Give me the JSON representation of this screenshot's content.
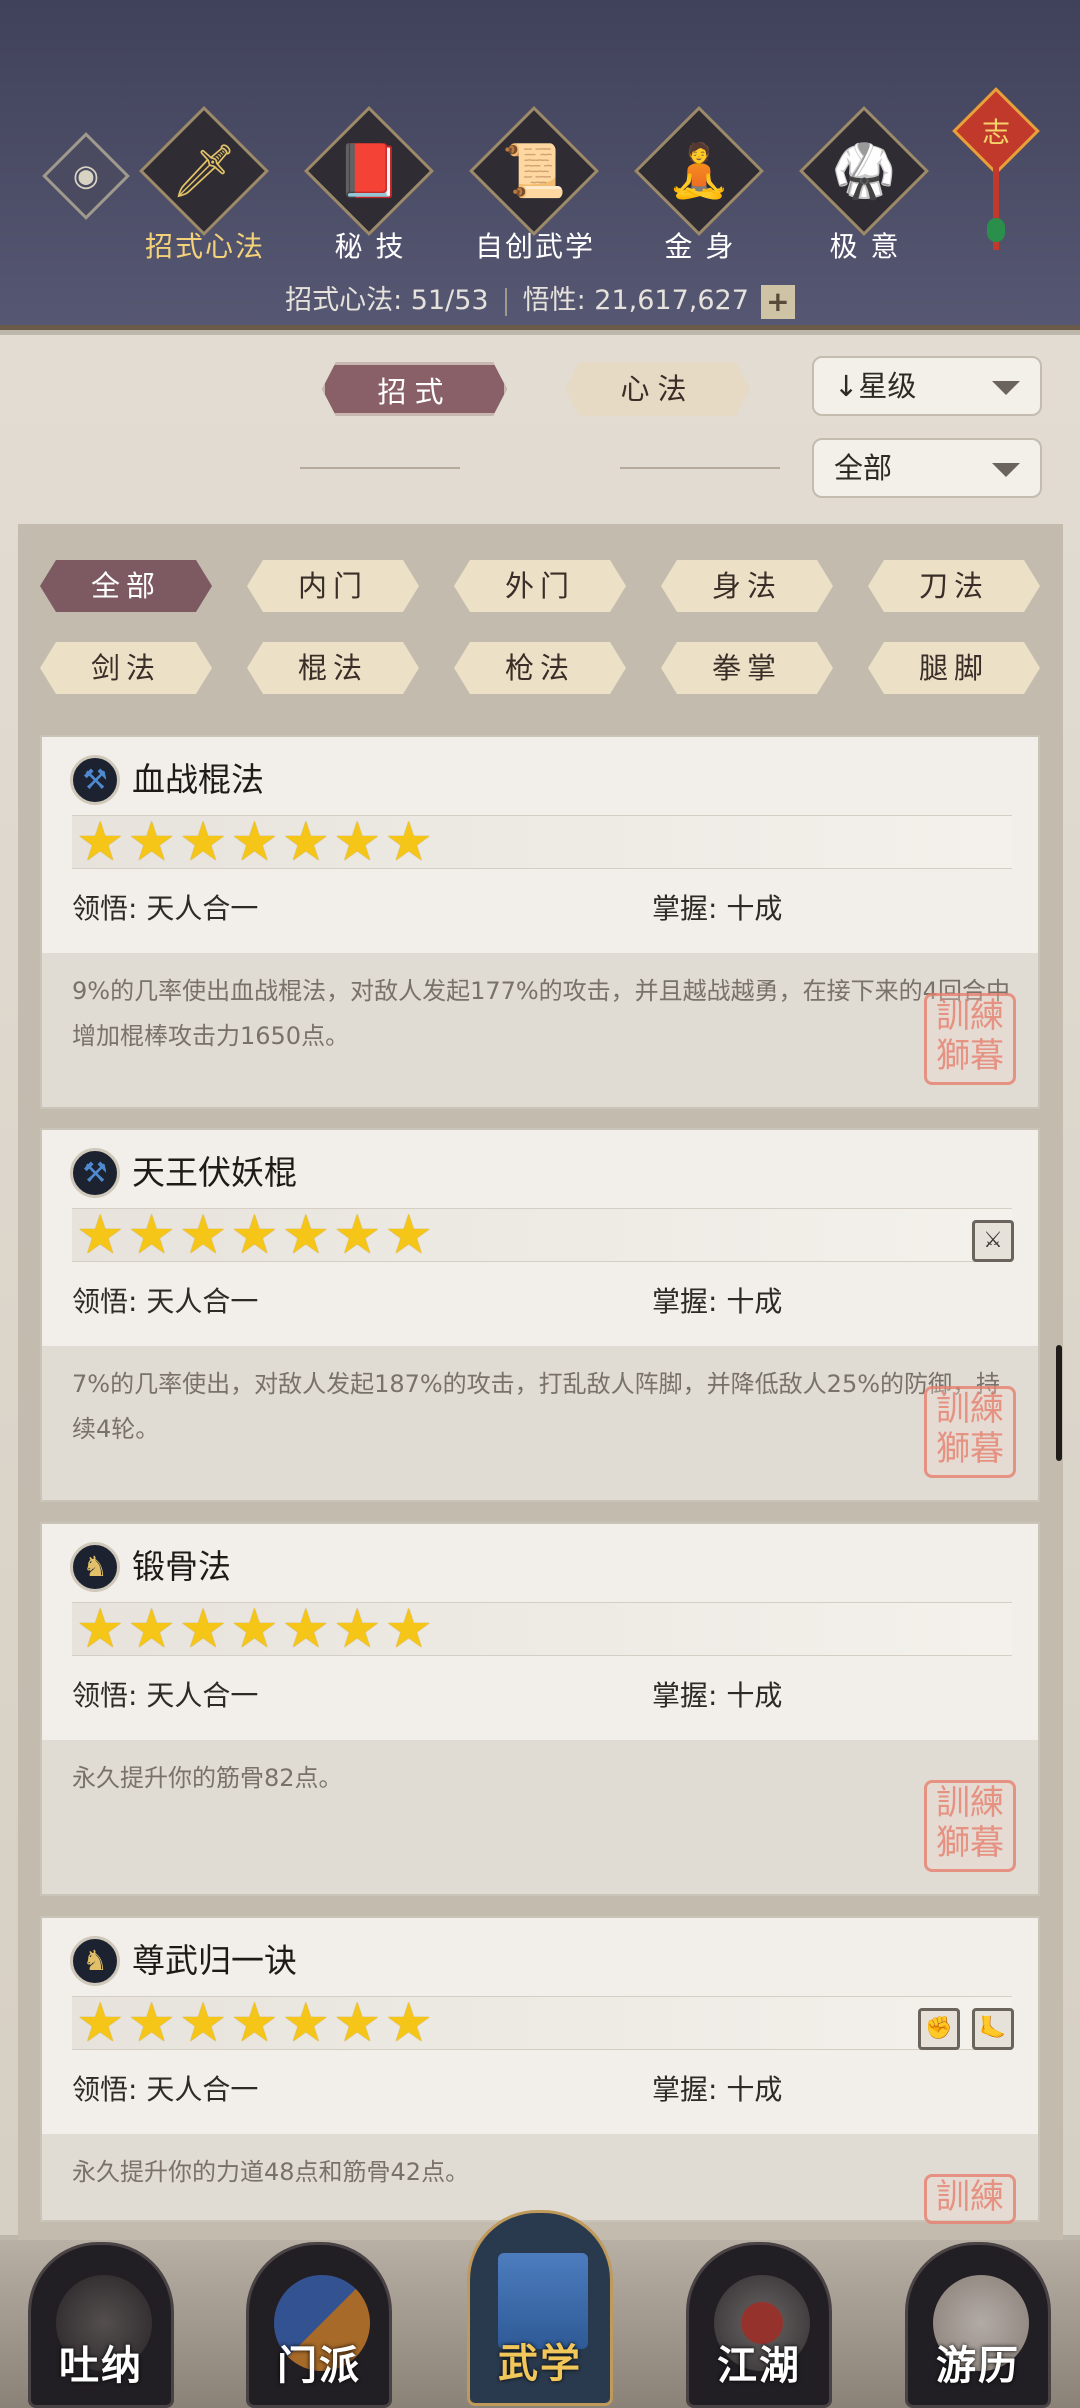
{
  "top_categories": [
    {
      "label": "招式心法",
      "icon": "sword-icon",
      "glyph": "🗡"
    },
    {
      "label": "秘 技",
      "icon": "book-icon",
      "glyph": "📕"
    },
    {
      "label": "自创武学",
      "icon": "scroll-icon",
      "glyph": "📜"
    },
    {
      "label": "金 身",
      "icon": "meditation-icon",
      "glyph": "🧘"
    },
    {
      "label": "极 意",
      "icon": "martial-stance-icon",
      "glyph": "🥋"
    }
  ],
  "knot_char": "志",
  "stats": {
    "moves_label": "招式心法: 51/53",
    "insight_label": "悟性: 21,617,627",
    "plus": "+"
  },
  "tabs": {
    "moves": "招式",
    "methods": "心法"
  },
  "sort": {
    "label": "星级",
    "filter": "全部"
  },
  "filters": [
    "全部",
    "内门",
    "外门",
    "身法",
    "刀法",
    "剑法",
    "棍法",
    "枪法",
    "拳掌",
    "腿脚"
  ],
  "cards": [
    {
      "name": "血战棍法",
      "stars": "★★★★★★★",
      "comprehension": "领悟: 天人合一",
      "mastery": "掌握: 十成",
      "desc": "9%的几率使出血战棍法，对敌人发起177%的攻击，并且越战越勇，在接下来的4回合中增加棍棒攻击力1650点。",
      "icon": "staff-skill-icon"
    },
    {
      "name": "天王伏妖棍",
      "stars": "★★★★★★★",
      "comprehension": "领悟: 天人合一",
      "mastery": "掌握: 十成",
      "desc": "7%的几率使出，对敌人发起187%的攻击，打乱敌人阵脚，并降低敌人25%的防御，持续4轮。",
      "icon": "staff-skill-icon"
    },
    {
      "name": "锻骨法",
      "stars": "★★★★★★★",
      "comprehension": "领悟: 天人合一",
      "mastery": "掌握: 十成",
      "desc": "永久提升你的筋骨82点。",
      "icon": "body-skill-icon"
    },
    {
      "name": "尊武归一诀",
      "stars": "★★★★★★★",
      "comprehension": "领悟: 天人合一",
      "mastery": "掌握: 十成",
      "desc": "永久提升你的力道48点和筋骨42点。",
      "icon": "body-skill-icon"
    }
  ],
  "seal_text": "訓練獅暮",
  "bottom_nav": [
    "吐纳",
    "门派",
    "武学",
    "江湖",
    "游历"
  ]
}
